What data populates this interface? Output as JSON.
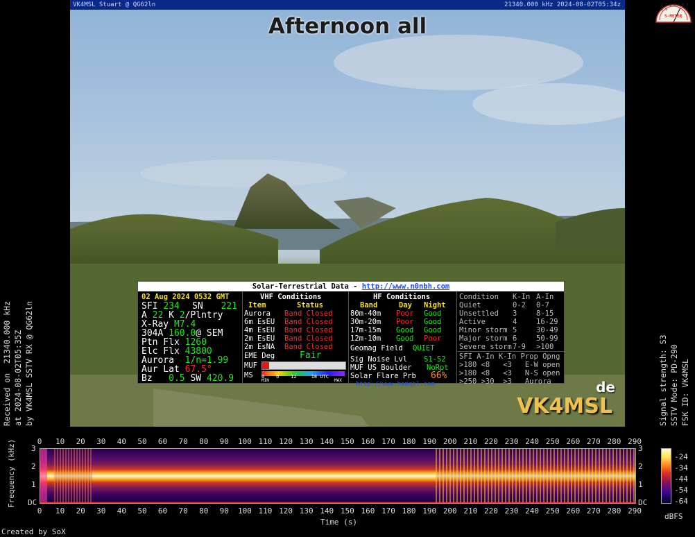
{
  "sstv": {
    "header_left": "VK4MSL Stuart @ QG62ln",
    "header_right": "21340.000 kHz 2024-08-02T05:34z",
    "title": "Afternoon all",
    "de": "de",
    "callsign": "VK4MSL"
  },
  "solar": {
    "title": "Solar-Terrestrial Data - ",
    "url": "http://www.n0nbh.com",
    "date": "02 Aug 2024 0532 GMT",
    "sfi_label": "SFI",
    "sfi": "234",
    "sn_label": "SN",
    "sn": "221",
    "a_label": "A",
    "a": "22",
    "k_label": "K",
    "k": "2",
    "k_text": "Plntry",
    "xray_label": "X-Ray",
    "xray": "M7.4",
    "304a_label": "304A",
    "304a": "160.0",
    "304a_unit": "@ SEM",
    "ptn_label": "Ptn Flx",
    "ptn": "1260",
    "elc_label": "Elc Flx",
    "elc": "43800",
    "aurora_label": "Aurora",
    "aurora": "1/n=1.99",
    "aurlat_label": "Aur Lat",
    "aurlat": "67.5°",
    "bz_label": "Bz",
    "bz": "0.5",
    "sw_label": "SW",
    "sw": "420.9",
    "vhf_title": "VHF Conditions",
    "vhf_item": "Item",
    "vhf_status": "Status",
    "vhf_rows": [
      {
        "item": "Aurora",
        "status": "Band Closed"
      },
      {
        "item": "6m EsEU",
        "status": "Band Closed"
      },
      {
        "item": "4m EsEU",
        "status": "Band Closed"
      },
      {
        "item": "2m EsEU",
        "status": "Band Closed"
      },
      {
        "item": "2m EsNA",
        "status": "Band Closed"
      }
    ],
    "eme_label": "EME Deg",
    "eme": "Fair",
    "muf_label": "MUF",
    "ms_label": "MS",
    "muf_ticks": [
      "0",
      "6",
      "12",
      "18",
      "UTC"
    ],
    "muf_min": "MIN",
    "muf_max": "MAX",
    "hf_title": "HF Conditions",
    "hf_band": "Band",
    "hf_day": "Day",
    "hf_night": "Night",
    "hf_rows": [
      {
        "band": "80m-40m",
        "day": "Poor",
        "night": "Good"
      },
      {
        "band": "30m-20m",
        "day": "Poor",
        "night": "Good"
      },
      {
        "band": "17m-15m",
        "day": "Good",
        "night": "Good"
      },
      {
        "band": "12m-10m",
        "day": "Good",
        "night": "Poor"
      }
    ],
    "geomag_label": "Geomag Field",
    "geomag": "QUIET",
    "signoise_label": "Sig Noise Lvl",
    "signoise": "S1-S2",
    "muf_boulder_label": "MUF US Boulder",
    "muf_boulder": "NoRpt",
    "flare_label": "Solar Flare Prb",
    "flare": "66%",
    "footer_url": "http://www.hamqsl.com",
    "cond_headers": [
      "Condition",
      "K-In",
      "A-In"
    ],
    "cond_rows": [
      [
        "Quiet",
        "0-2",
        "0-7"
      ],
      [
        "Unsettled",
        "3",
        "8-15"
      ],
      [
        "Active",
        "4",
        "16-29"
      ],
      [
        "Minor storm",
        "5",
        "30-49"
      ],
      [
        "Major storm",
        "6",
        "50-99"
      ],
      [
        "Severe storm",
        "7-9",
        ">100"
      ]
    ],
    "prop_headers": "SFI A-In K-In Prop Opng",
    "prop_rows": [
      ">180 <8   <3   E-W open",
      ">180 <8   <3   N-S open",
      ">250 >30  >3   Aurora"
    ]
  },
  "left_info": {
    "line1": "Received on  21340.000 kHz",
    "line2": "at 2024-08-02T05:35Z",
    "line3": "by VK4MSL SSTV RX @ QG62ln"
  },
  "right_info": {
    "line1": "Signal strength: S3",
    "line2": "SSTV Mode: PD-290",
    "line3": "FSK ID: VK4MSL"
  },
  "spectrogram": {
    "x_ticks": [
      "0",
      "10",
      "20",
      "30",
      "40",
      "50",
      "60",
      "70",
      "80",
      "90",
      "100",
      "110",
      "120",
      "130",
      "140",
      "150",
      "160",
      "170",
      "180",
      "190",
      "200",
      "210",
      "220",
      "230",
      "240",
      "250",
      "260",
      "270",
      "280",
      "290"
    ],
    "y_ticks": [
      "3",
      "2",
      "1",
      "DC"
    ],
    "ylabel": "Frequency (kHz)",
    "xlabel": "Time (s)",
    "colorbar_ticks": [
      "-24",
      "-34",
      "-44",
      "-54",
      "-64"
    ],
    "colorbar_label": "dBFS",
    "credit": "Created by SoX"
  },
  "meter": {
    "scale": "1 2 3 4 5 6 7 8 9",
    "label": "S-METER"
  }
}
